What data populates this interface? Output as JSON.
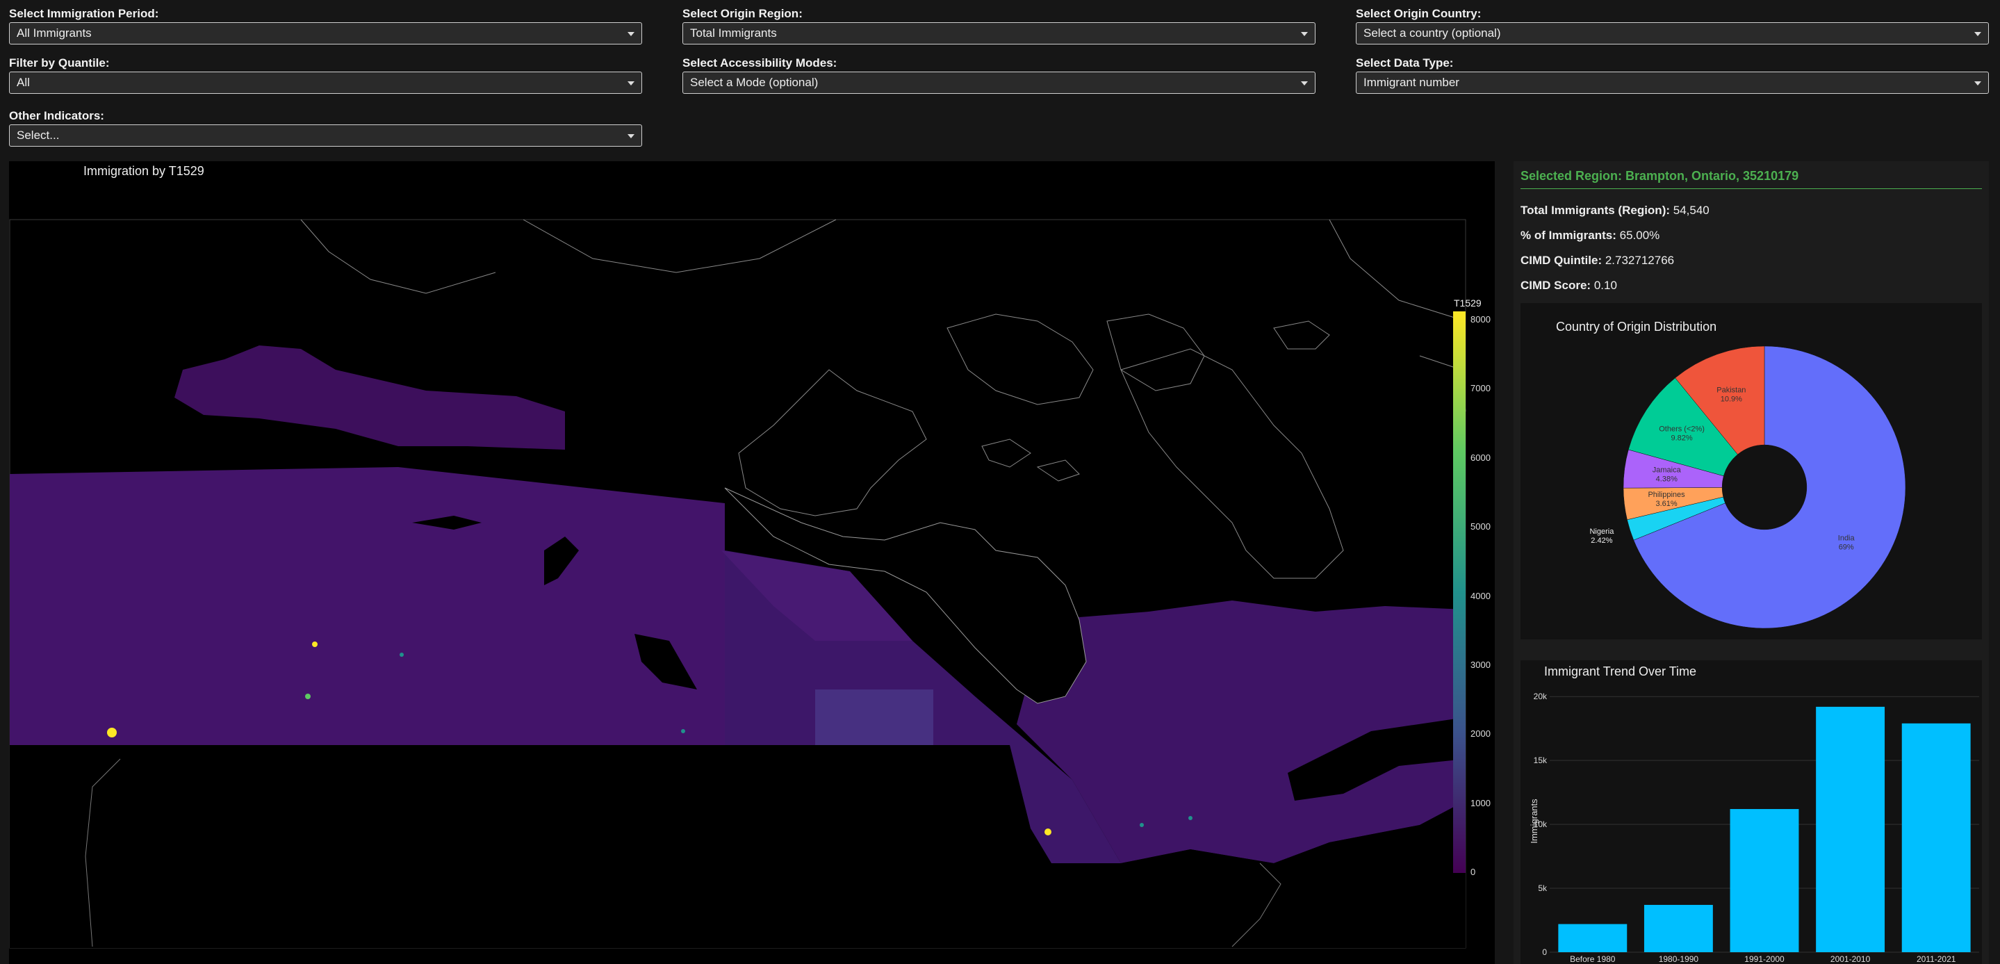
{
  "controls": [
    {
      "name": "immigration-period-select",
      "label": "Select Immigration Period:",
      "value": "All Immigrants"
    },
    {
      "name": "origin-region-select",
      "label": "Select Origin Region:",
      "value": "Total Immigrants"
    },
    {
      "name": "origin-country-select",
      "label": "Select Origin Country:",
      "value": "Select a country (optional)"
    },
    {
      "name": "quantile-filter-select",
      "label": "Filter by Quantile:",
      "value": "All"
    },
    {
      "name": "accessibility-modes-select",
      "label": "Select Accessibility Modes:",
      "value": "Select a Mode (optional)"
    },
    {
      "name": "data-type-select",
      "label": "Select Data Type:",
      "value": "Immigrant number"
    },
    {
      "name": "other-indicators-select",
      "label": "Other Indicators:",
      "value": "Select..."
    }
  ],
  "map": {
    "title": "Immigration by T1529",
    "colorbar_title": "T1529",
    "colorbar_ticks": [
      "8000",
      "7000",
      "6000",
      "5000",
      "4000",
      "3000",
      "2000",
      "1000",
      "0"
    ],
    "colorscale": [
      "#440154",
      "#3b528b",
      "#21918c",
      "#5ec962",
      "#fde725"
    ]
  },
  "sidebar": {
    "selected_region": "Selected Region: Brampton, Ontario, 35210179",
    "stats": [
      {
        "label": "Total Immigrants (Region):",
        "value": "54,540"
      },
      {
        "label": "% of Immigrants:",
        "value": "65.00%"
      },
      {
        "label": "CIMD Quintile:",
        "value": "2.732712766"
      },
      {
        "label": "CIMD Score:",
        "value": "0.10"
      }
    ],
    "accent_color": "#4cb050"
  },
  "chart_data": [
    {
      "type": "pie",
      "title": "Country of Origin Distribution",
      "hole": 0.3,
      "slices": [
        {
          "label": "India",
          "percent_label": "69%",
          "value": 68.9,
          "color": "#636efa"
        },
        {
          "label": "Nigeria",
          "percent_label": "2.42%",
          "value": 2.42,
          "color": "#19d3f3"
        },
        {
          "label": "Philippines",
          "percent_label": "3.61%",
          "value": 3.61,
          "color": "#ffa15a"
        },
        {
          "label": "Jamaica",
          "percent_label": "4.38%",
          "value": 4.38,
          "color": "#ab63fa"
        },
        {
          "label": "Others (<2%)",
          "percent_label": "9.82%",
          "value": 9.82,
          "color": "#00cc96"
        },
        {
          "label": "Pakistan",
          "percent_label": "10.9%",
          "value": 10.9,
          "color": "#ef553b"
        }
      ]
    },
    {
      "type": "bar",
      "title": "Immigrant Trend Over Time",
      "ylabel": "Immigrants",
      "categories": [
        "Before 1980",
        "1980-1990",
        "1991-2000",
        "2001-2010",
        "2011-2021"
      ],
      "values": [
        2200,
        3700,
        11200,
        19200,
        17900
      ],
      "ylim": [
        0,
        20500
      ],
      "yticks": [
        0,
        5000,
        10000,
        15000,
        20000
      ],
      "ytick_labels": [
        "0",
        "5k",
        "10k",
        "15k",
        "20k"
      ],
      "color": "#00bfff",
      "grid": true
    }
  ]
}
